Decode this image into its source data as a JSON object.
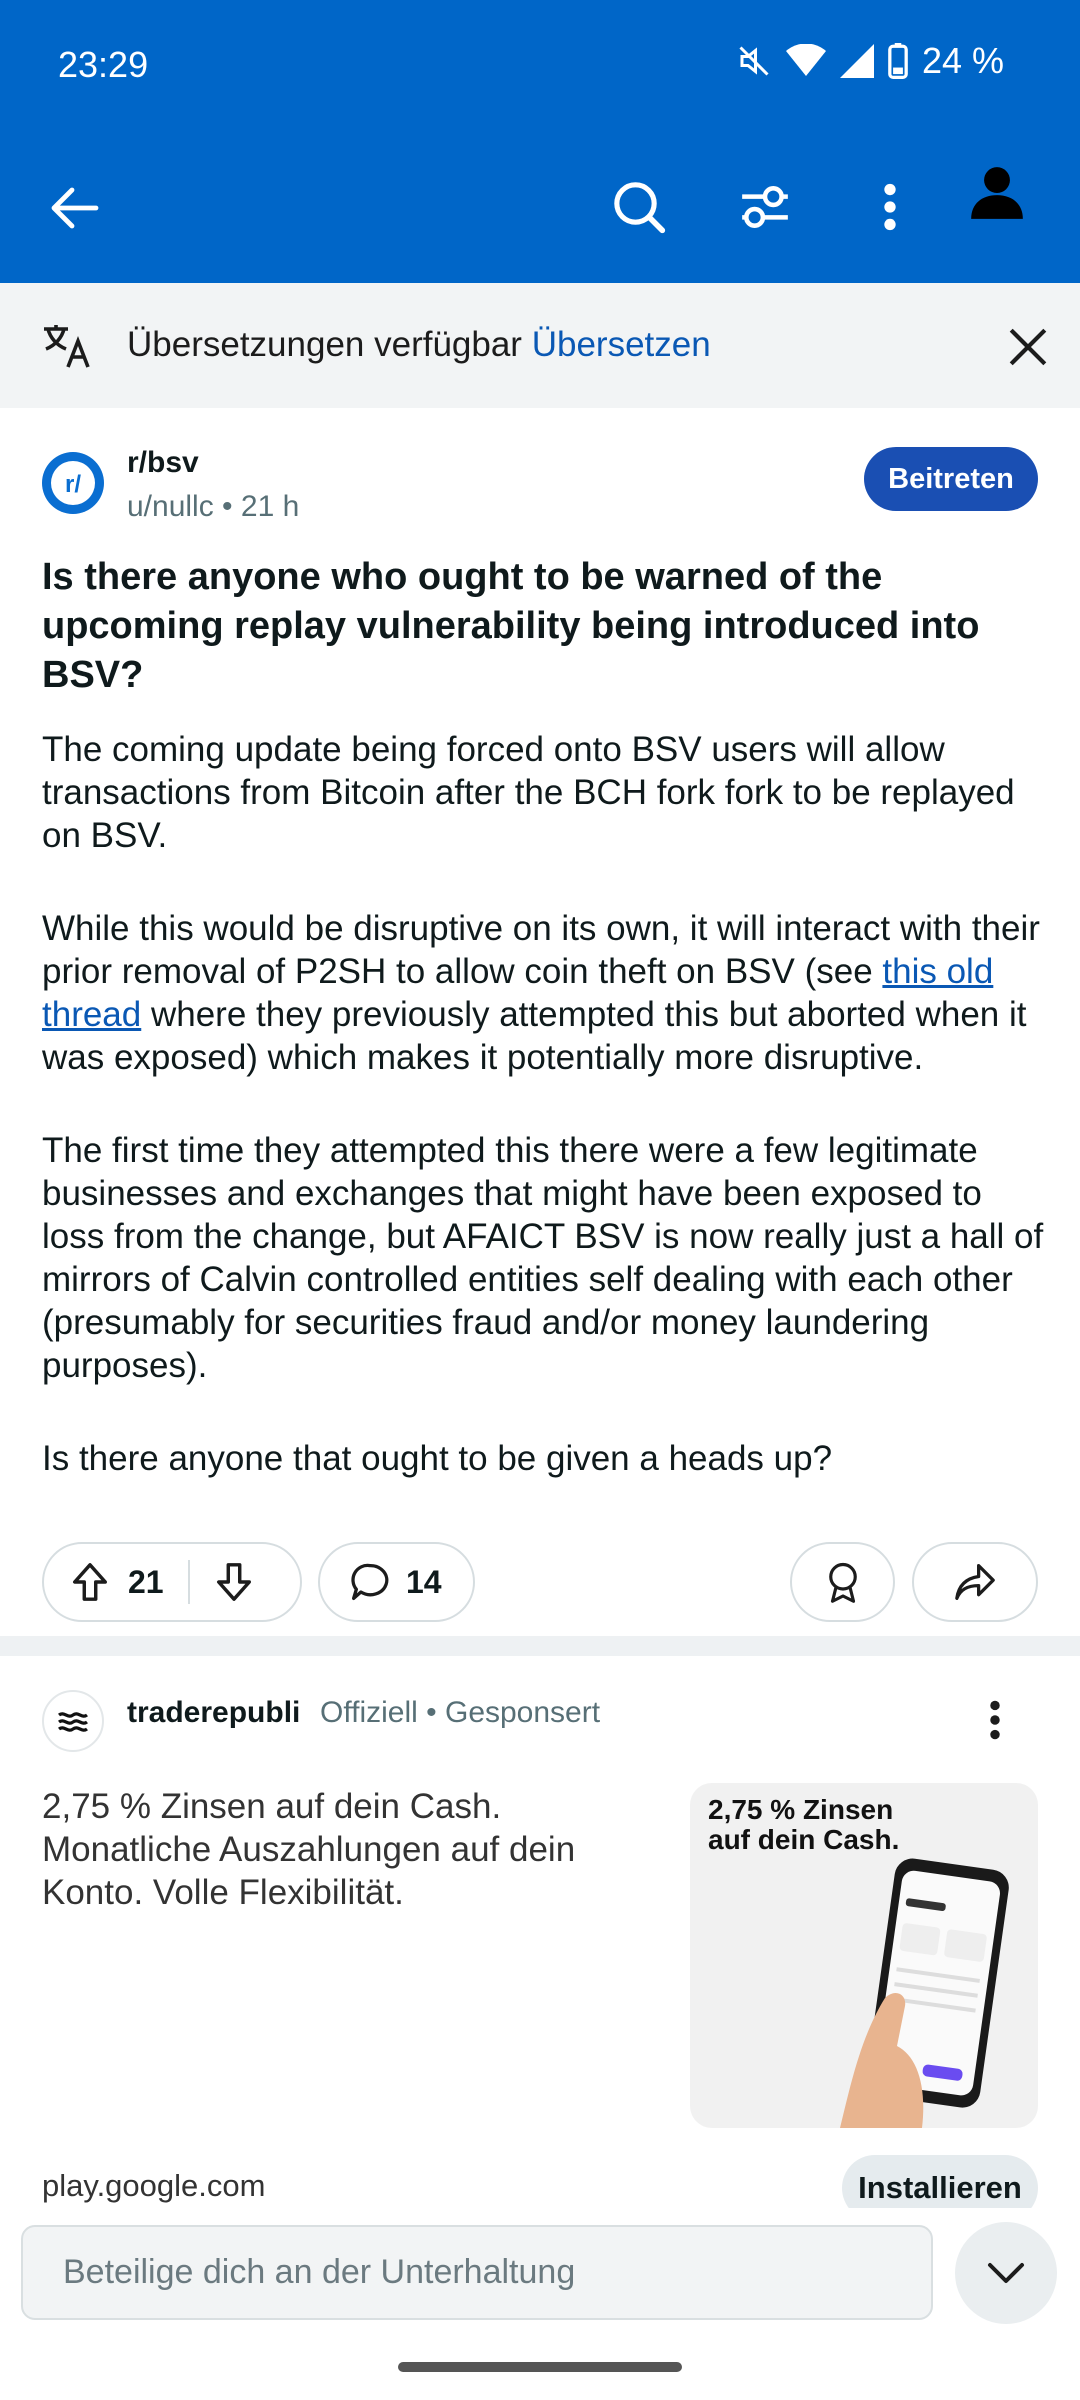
{
  "status_bar": {
    "time": "23:29",
    "battery": "24 %"
  },
  "translation_bar": {
    "text": "Übersetzungen verfügbar",
    "action": "Übersetzen"
  },
  "post": {
    "subreddit": "r/bsv",
    "author": "u/nullc",
    "age": "21 h",
    "join_label": "Beitreten",
    "title": "Is there anyone who ought to be warned of the upcoming replay vulnerability being introduced into BSV?",
    "body_p1": "The coming update being forced onto BSV users will allow transactions from Bitcoin after the BCH fork fork to be replayed on BSV.",
    "body_p2_a": "While this would be disruptive on its own, it will interact with their prior removal of P2SH to allow coin theft on BSV  (see ",
    "body_p2_link": "this old thread",
    "body_p2_b": " where they previously attempted this but aborted when it was exposed) which makes it potentially more disruptive.",
    "body_p3": "The first time they attempted this there were a few legitimate businesses and exchanges that might have been exposed to loss from the change, but AFAICT BSV is now really just a hall of mirrors of Calvin controlled entities self dealing with each other (presumably for securities fraud and/or money laundering purposes).",
    "body_p4": "Is there anyone that ought to be given a heads up?",
    "upvotes": "21",
    "comments": "14"
  },
  "ad": {
    "advertiser": "traderepubli",
    "meta": "Offiziell • Gesponsert",
    "text": "2,75 % Zinsen auf dein Cash. Monatliche Auszahlungen auf dein Konto. Volle Flexibilität.",
    "image_headline": "2,75 % Zinsen auf dein Cash.",
    "domain": "play.google.com",
    "install_label": "Installieren"
  },
  "comment_box": {
    "placeholder": "Beteilige dich an der Unterhaltung"
  },
  "colors": {
    "header_blue": "#0066c8",
    "join_blue": "#1a4fb3",
    "link_blue": "#0a58b4"
  }
}
